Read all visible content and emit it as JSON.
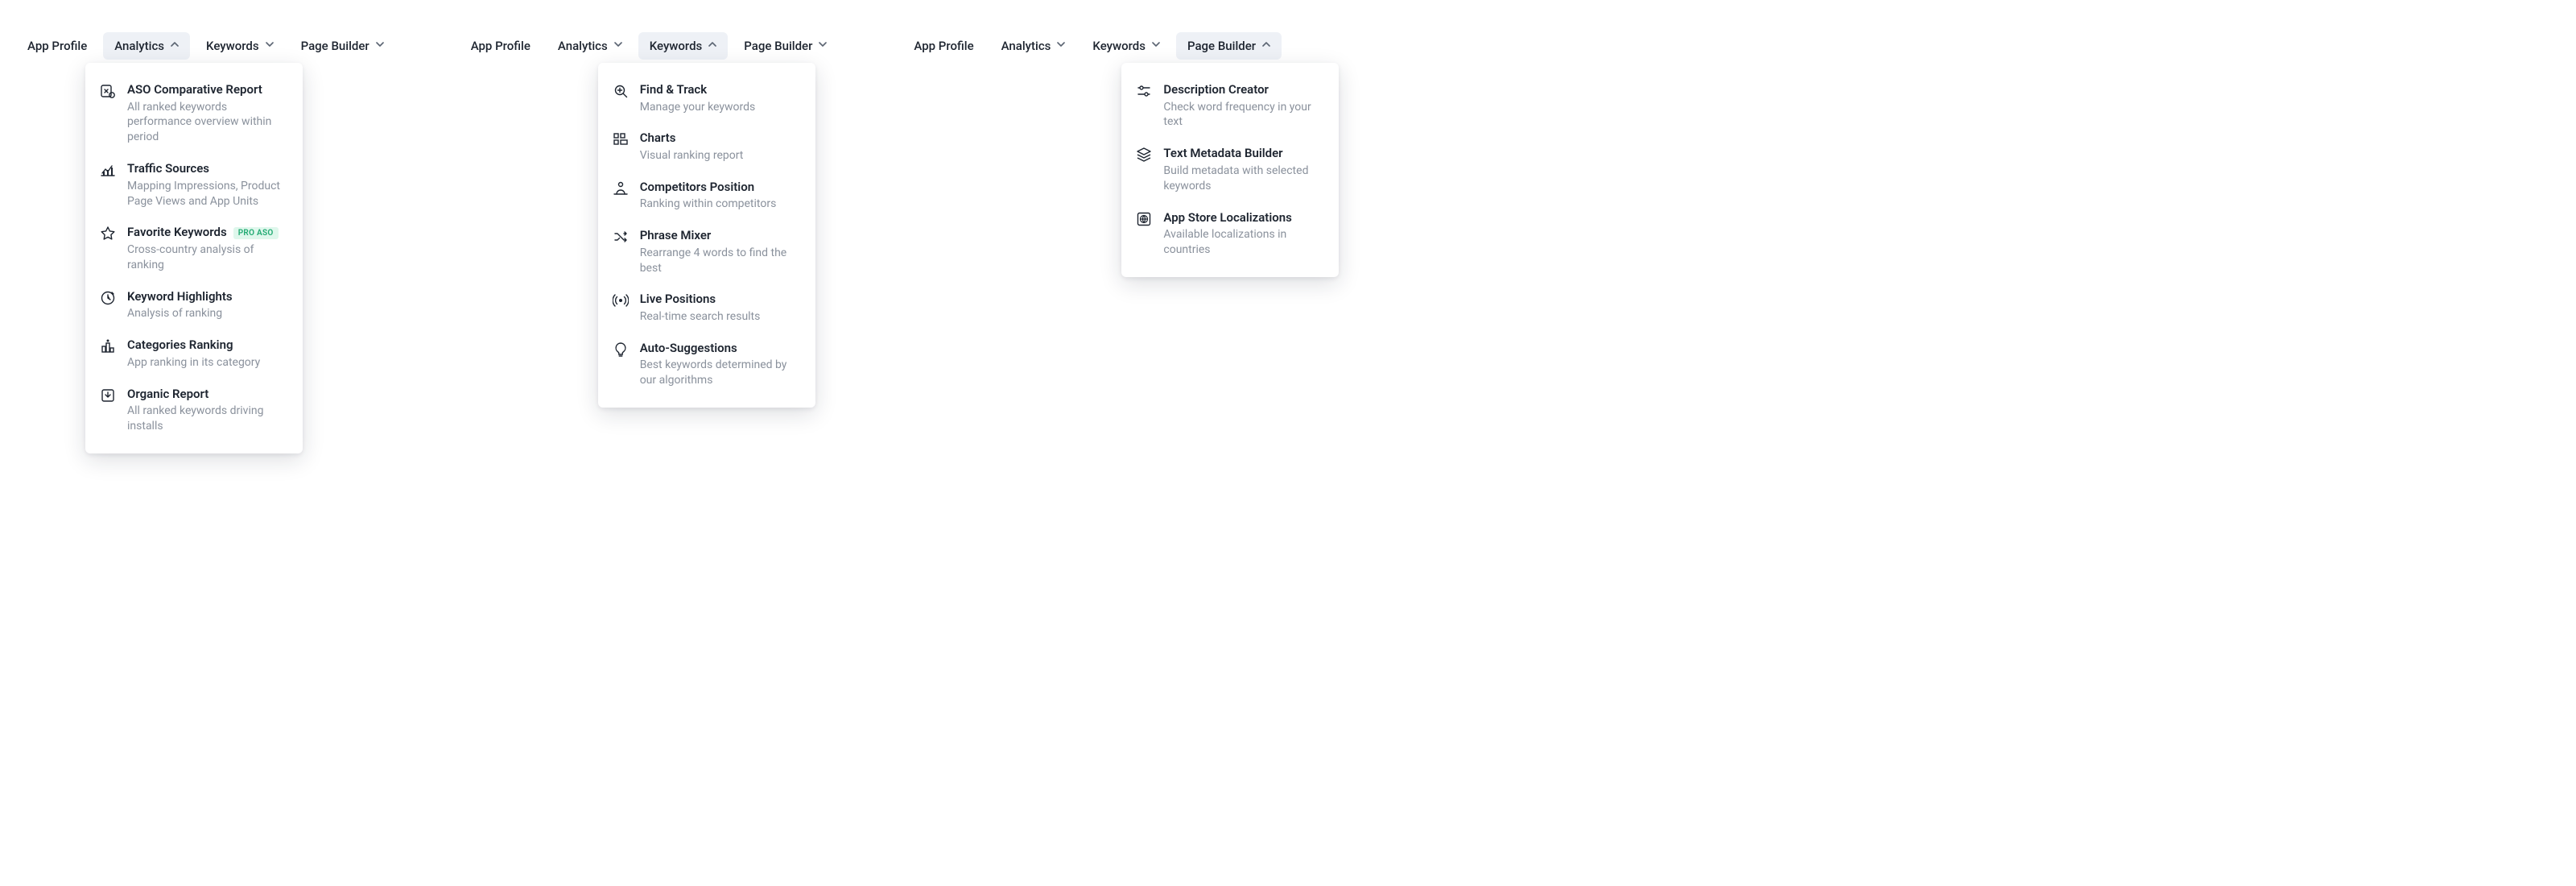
{
  "tabs": {
    "app_profile": "App Profile",
    "analytics": "Analytics",
    "keywords": "Keywords",
    "page_builder": "Page Builder"
  },
  "badges": {
    "pro_aso": "PRO ASO"
  },
  "menus": {
    "analytics": [
      {
        "icon": "doc-compare-icon",
        "title": "ASO Comparative Report",
        "desc": "All ranked keywords performance overview within period"
      },
      {
        "icon": "traffic-chart-icon",
        "title": "Traffic Sources",
        "desc": "Mapping Impressions, Product Page Views and App Units"
      },
      {
        "icon": "star-icon",
        "title": "Favorite Keywords",
        "desc": "Cross-country analysis of ranking",
        "badge": "pro_aso"
      },
      {
        "icon": "clock-highlight-icon",
        "title": "Keyword Highlights",
        "desc": "Analysis of ranking"
      },
      {
        "icon": "podium-icon",
        "title": "Categories Ranking",
        "desc": "App ranking in its category"
      },
      {
        "icon": "download-report-icon",
        "title": "Organic Report",
        "desc": "All ranked keywords driving installs"
      }
    ],
    "keywords": [
      {
        "icon": "search-plus-icon",
        "title": "Find & Track",
        "desc": "Manage your keywords"
      },
      {
        "icon": "grid-chart-icon",
        "title": "Charts",
        "desc": "Visual ranking report"
      },
      {
        "icon": "person-rank-icon",
        "title": "Competitors Position",
        "desc": "Ranking within competitors"
      },
      {
        "icon": "shuffle-icon",
        "title": "Phrase Mixer",
        "desc": "Rearrange 4 words to find the best"
      },
      {
        "icon": "live-signal-icon",
        "title": "Live Positions",
        "desc": "Real-time search results"
      },
      {
        "icon": "bulb-icon",
        "title": "Auto-Suggestions",
        "desc": "Best keywords determined by our algorithms"
      }
    ],
    "page_builder": [
      {
        "icon": "slider-icon",
        "title": "Description Creator",
        "desc": "Check word frequency in your text"
      },
      {
        "icon": "layers-icon",
        "title": "Text Metadata Builder",
        "desc": "Build metadata with selected keywords"
      },
      {
        "icon": "globe-icon",
        "title": "App Store Localizations",
        "desc": "Available localizations in countries"
      }
    ]
  }
}
